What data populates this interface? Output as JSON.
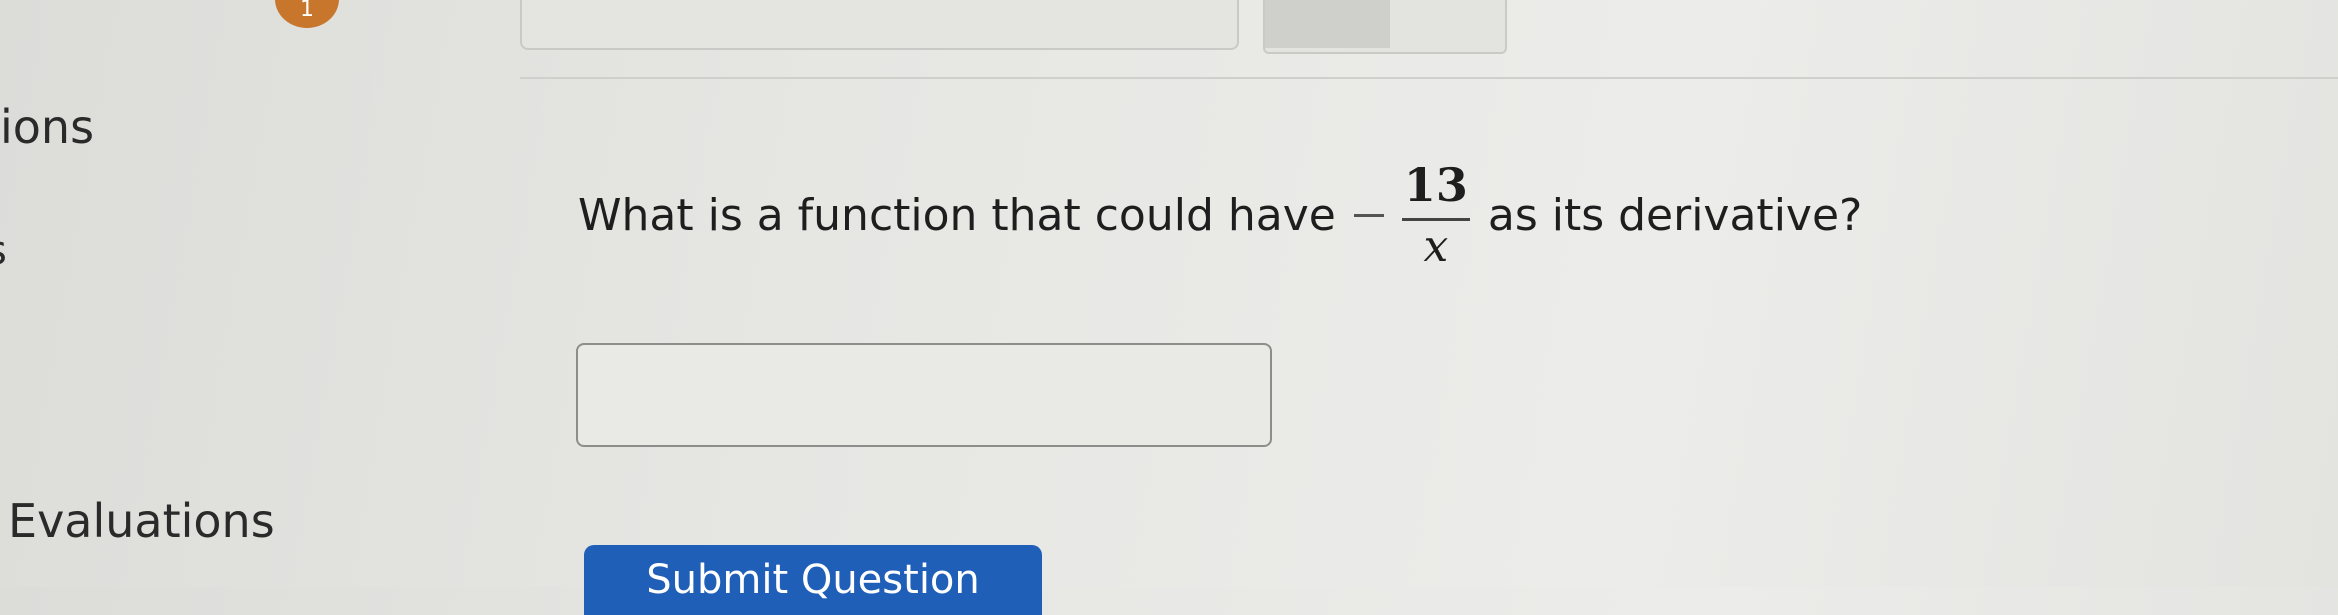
{
  "top": {
    "badge_label": "1"
  },
  "sidebar": {
    "items": [
      {
        "label": "ions"
      },
      {
        "label": "s"
      },
      {
        "label": "Evaluations"
      }
    ]
  },
  "question": {
    "prefix": "What is a function that could have",
    "minus_sign": "−",
    "fraction_numerator": "13",
    "fraction_denominator": "x",
    "suffix": "as its derivative?"
  },
  "answer": {
    "value": "",
    "placeholder": ""
  },
  "submit": {
    "label": "Submit Question",
    "color": "#1f5fb8"
  }
}
